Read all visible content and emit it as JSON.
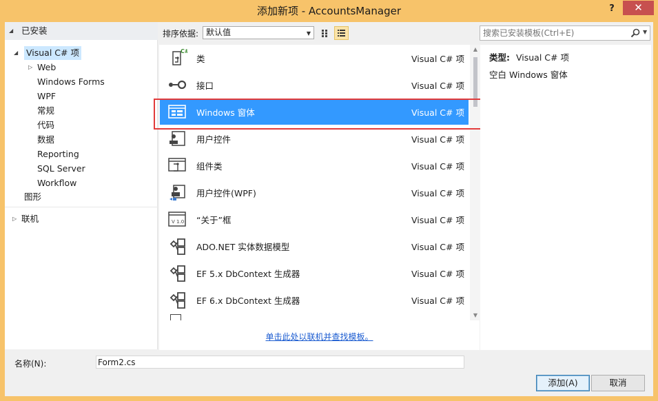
{
  "window": {
    "title": "添加新项 - AccountsManager",
    "help": "?",
    "close": "✕"
  },
  "tree": {
    "installed_header": "已安装",
    "root": "Visual C# 项",
    "web": "Web",
    "children": [
      "Windows Forms",
      "WPF",
      "常规",
      "代码",
      "数据",
      "Reporting",
      "SQL Server",
      "Workflow"
    ],
    "graphics": "图形",
    "online": "联机"
  },
  "toolbar": {
    "sort_label": "排序依据:",
    "sort_value": "默认值"
  },
  "search": {
    "placeholder": "搜索已安装模板(Ctrl+E)"
  },
  "templates": [
    {
      "name": "类",
      "category": "Visual C# 项",
      "icon": "class-icon"
    },
    {
      "name": "接口",
      "category": "Visual C# 项",
      "icon": "interface-icon"
    },
    {
      "name": "Windows 窗体",
      "category": "Visual C# 项",
      "icon": "windows-form-icon"
    },
    {
      "name": "用户控件",
      "category": "Visual C# 项",
      "icon": "user-control-icon"
    },
    {
      "name": "组件类",
      "category": "Visual C# 项",
      "icon": "component-class-icon"
    },
    {
      "name": "用户控件(WPF)",
      "category": "Visual C# 项",
      "icon": "wpf-user-control-icon"
    },
    {
      "name": "“关于”框",
      "category": "Visual C# 项",
      "icon": "about-box-icon"
    },
    {
      "name": "ADO.NET 实体数据模型",
      "category": "Visual C# 项",
      "icon": "entity-model-icon"
    },
    {
      "name": "EF 5.x DbContext 生成器",
      "category": "Visual C# 项",
      "icon": "dbcontext-generator-icon"
    },
    {
      "name": "EF 6.x DbContext 生成器",
      "category": "Visual C# 项",
      "icon": "dbcontext-generator-icon"
    }
  ],
  "online_link": "单击此处以联机并查找模板。",
  "details": {
    "type_label": "类型:",
    "type_value": "Visual C# 项",
    "description": "空白 Windows 窗体"
  },
  "bottom": {
    "name_label": "名称(N):",
    "name_value": "Form2.cs",
    "add_button": "添加(A)",
    "cancel_button": "取消"
  },
  "colors": {
    "title_bar": "#f7c36a",
    "selection": "#3399ff",
    "highlight_border": "#e23a3a",
    "close_button": "#c7504f",
    "link": "#1a5bd0"
  }
}
